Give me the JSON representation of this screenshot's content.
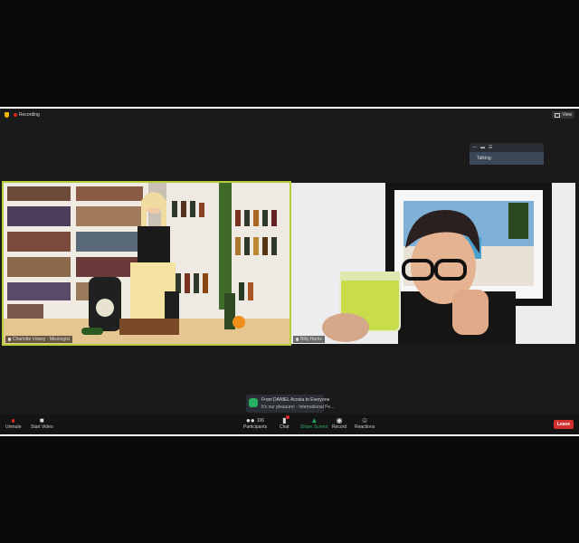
{
  "meeting": {
    "recording_label": "Recording",
    "view_label": "View"
  },
  "talking_panel": {
    "controls": [
      "—",
      "▬",
      "☰"
    ],
    "label": "Talking:"
  },
  "participants": [
    {
      "name": "Charlotte Voisey - Mixologist",
      "muted": false
    },
    {
      "name": "Billy Harris",
      "muted": false
    }
  ],
  "chat_notification": {
    "from": "From DANIEL Acosta to Everyone",
    "message": "It's our pleasure! - International Pe..."
  },
  "toolbar": {
    "unmute": "Unmute",
    "start_video": "Start Video",
    "participants": "Participants",
    "participants_count": "106",
    "chat": "Chat",
    "share_screen": "Share Screen",
    "record": "Record",
    "reactions": "Reactions",
    "leave": "Leave"
  },
  "colors": {
    "active_speaker_border": "#b5ce3a",
    "share_screen": "#27ae60",
    "leave": "#d32f2f",
    "recording": "#e02828"
  }
}
